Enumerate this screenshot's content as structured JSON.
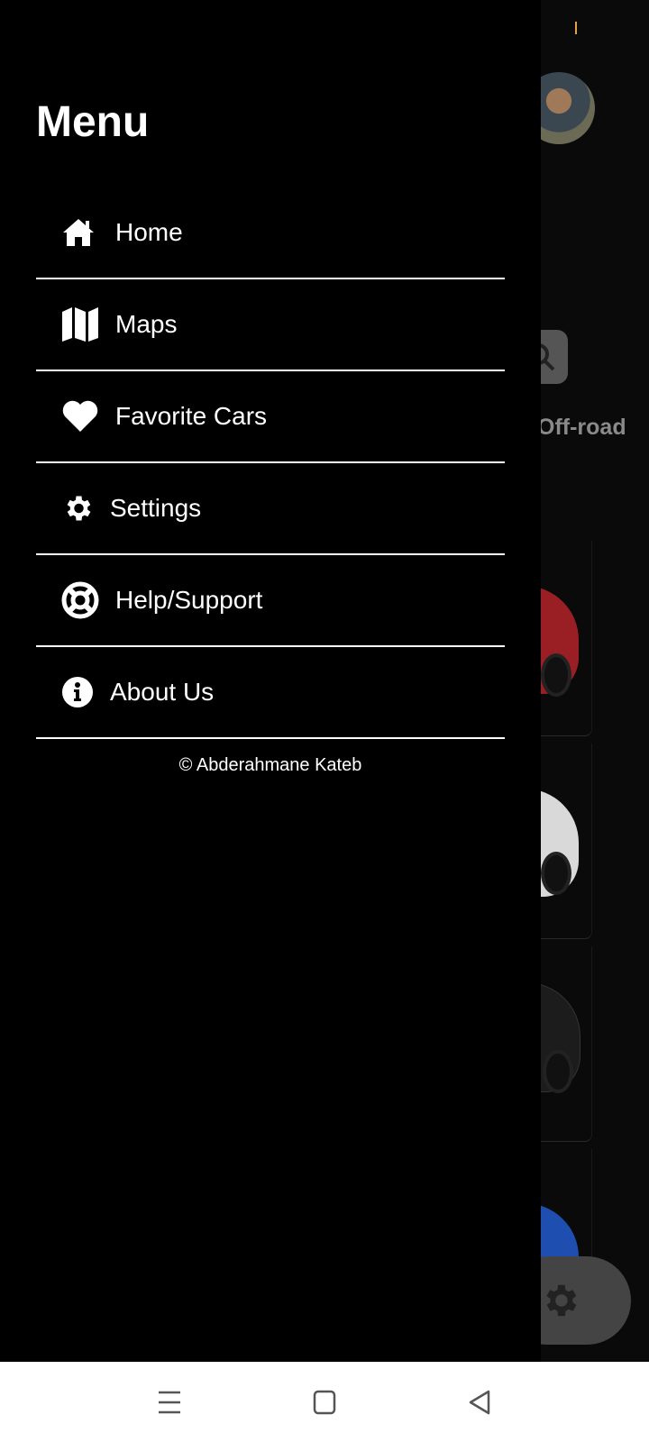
{
  "background": {
    "chip_label": "Off-road",
    "cards": [
      {
        "car_color": "#9a1f24"
      },
      {
        "car_color": "#d9d9d9"
      },
      {
        "car_color": "#1c1c1c"
      },
      {
        "car_color": "#1e4fb0"
      }
    ]
  },
  "drawer": {
    "title": "Menu",
    "items": [
      {
        "label": "Home",
        "icon": "home-icon"
      },
      {
        "label": "Maps",
        "icon": "map-icon"
      },
      {
        "label": "Favorite Cars",
        "icon": "heart-icon"
      },
      {
        "label": "Settings",
        "icon": "gear-icon"
      },
      {
        "label": "Help/Support",
        "icon": "lifebuoy-icon"
      },
      {
        "label": "About Us",
        "icon": "info-icon"
      }
    ],
    "copyright": "© Abderahmane Kateb"
  },
  "system_nav": {
    "buttons": [
      "recents-icon",
      "home-square-icon",
      "back-triangle-icon"
    ]
  },
  "colors": {
    "drawer_bg": "#000000",
    "text": "#ffffff",
    "nav_bar_bg": "#ffffff"
  }
}
